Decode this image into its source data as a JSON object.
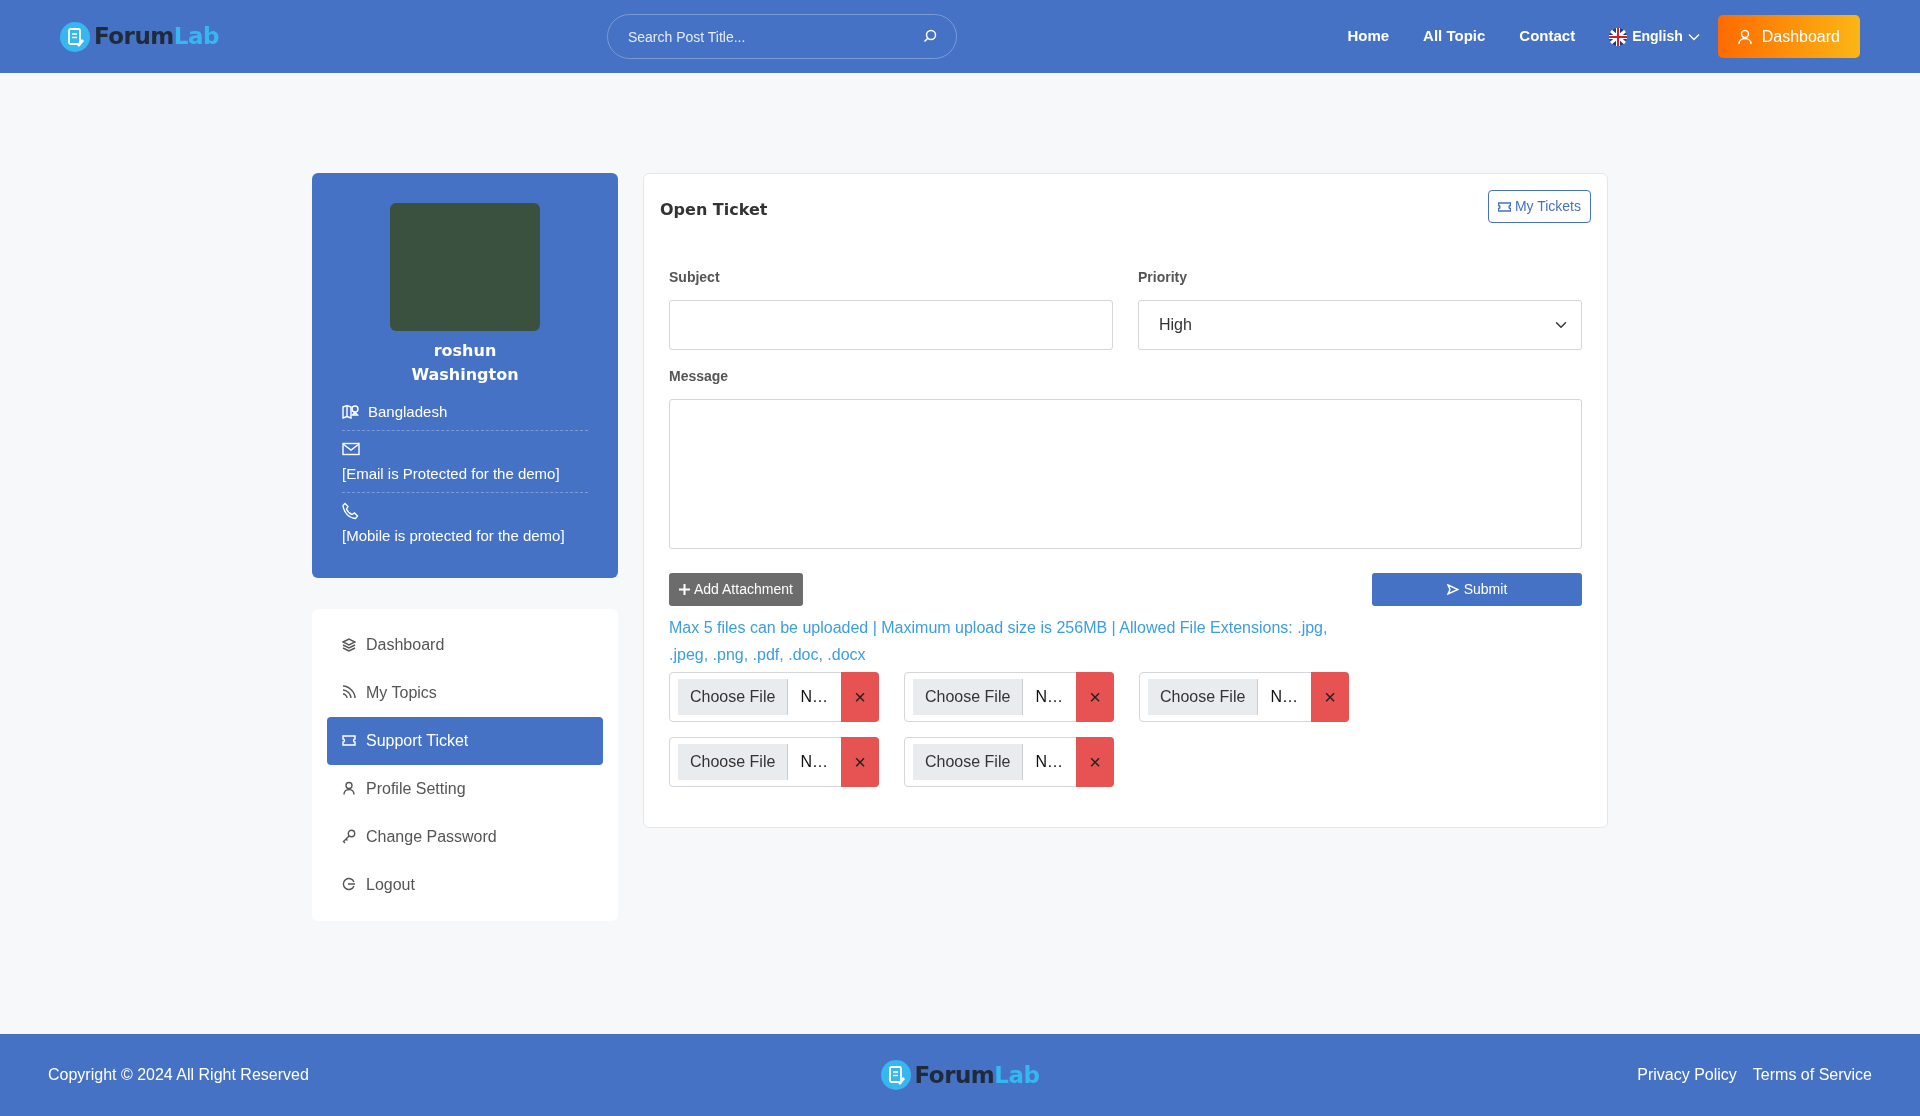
{
  "header": {
    "logo": {
      "part1": "Forum",
      "part2": "Lab"
    },
    "search": {
      "placeholder": "Search Post Title..."
    },
    "nav": [
      {
        "label": "Home"
      },
      {
        "label": "All Topic"
      },
      {
        "label": "Contact"
      }
    ],
    "language": "English",
    "dashboard_button": "Dashboard"
  },
  "profile": {
    "name": "roshun Washington",
    "details": [
      {
        "kind": "location",
        "text": "Bangladesh"
      },
      {
        "kind": "email",
        "text": "[Email is Protected for the demo]"
      },
      {
        "kind": "phone",
        "text": "[Mobile is protected for the demo]"
      }
    ]
  },
  "menu": [
    {
      "kind": "dashboard",
      "label": "Dashboard",
      "selected": false
    },
    {
      "kind": "topics",
      "label": "My Topics",
      "selected": false
    },
    {
      "kind": "ticket",
      "label": "Support Ticket",
      "selected": true
    },
    {
      "kind": "profile",
      "label": "Profile Setting",
      "selected": false
    },
    {
      "kind": "password",
      "label": "Change Password",
      "selected": false
    },
    {
      "kind": "logout",
      "label": "Logout",
      "selected": false
    }
  ],
  "ticket": {
    "title": "Open Ticket",
    "my_tickets_button": "My Tickets",
    "subject_label": "Subject",
    "priority_label": "Priority",
    "priority_value": "High",
    "message_label": "Message",
    "add_attachment_button": "Add Attachment",
    "submit_button": "Submit",
    "note": "Max 5 files can be uploaded | Maximum upload size is 256MB | Allowed File Extensions: .jpg, .jpeg, .png, .pdf, .doc, .docx",
    "attachments": [
      {
        "button": "Choose File",
        "file_name": "N…",
        "remove": "×"
      },
      {
        "button": "Choose File",
        "file_name": "N…",
        "remove": "×"
      },
      {
        "button": "Choose File",
        "file_name": "N…",
        "remove": "×"
      },
      {
        "button": "Choose File",
        "file_name": "N…",
        "remove": "×"
      },
      {
        "button": "Choose File",
        "file_name": "N…",
        "remove": "×"
      }
    ]
  },
  "footer": {
    "copyright": "Copyright © 2024 All Right Reserved",
    "logo": {
      "part1": "Forum",
      "part2": "Lab"
    },
    "links": [
      {
        "label": "Privacy Policy"
      },
      {
        "label": "Terms of Service"
      }
    ]
  }
}
